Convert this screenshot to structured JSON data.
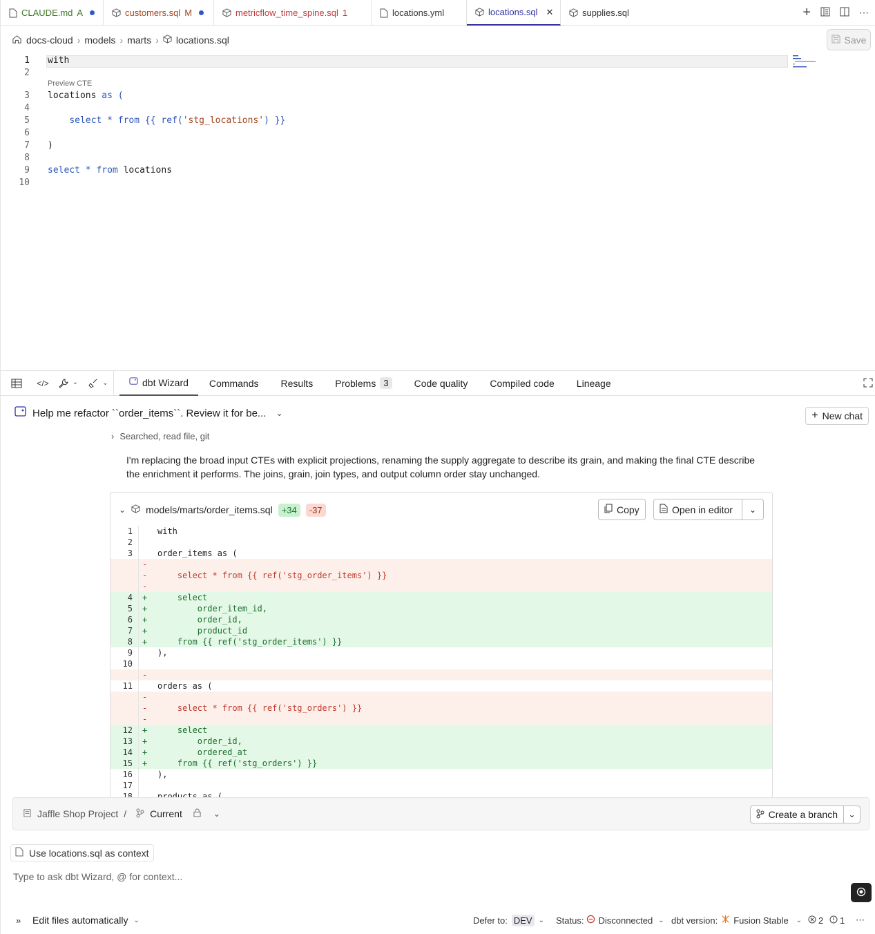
{
  "tabs": [
    {
      "label": "CLAUDE.md",
      "status": "A",
      "dot": true,
      "kind": "file"
    },
    {
      "label": "customers.sql",
      "status": "M",
      "dot": true,
      "kind": "model"
    },
    {
      "label": "metricflow_time_spine.sql",
      "status": "1",
      "dot": false,
      "kind": "model"
    },
    {
      "label": "locations.yml",
      "status": "",
      "dot": false,
      "kind": "file"
    },
    {
      "label": "locations.sql",
      "status": "",
      "dot": false,
      "kind": "model",
      "active": true
    },
    {
      "label": "supplies.sql",
      "status": "",
      "dot": false,
      "kind": "model"
    }
  ],
  "breadcrumb": [
    "docs-cloud",
    "models",
    "marts",
    "locations.sql"
  ],
  "save_label": "Save",
  "editor": {
    "preview_cte": "Preview CTE",
    "lines": [
      {
        "n": "1",
        "code": "with"
      },
      {
        "n": "2",
        "code": ""
      },
      {
        "n": "3",
        "code": "locations as ("
      },
      {
        "n": "4",
        "code": ""
      },
      {
        "n": "5",
        "code": "    select * from {{ ref('stg_locations') }}"
      },
      {
        "n": "6",
        "code": ""
      },
      {
        "n": "7",
        "code": ")"
      },
      {
        "n": "8",
        "code": ""
      },
      {
        "n": "9",
        "code": "select * from locations"
      },
      {
        "n": "10",
        "code": ""
      }
    ]
  },
  "panel": {
    "tabs": [
      "dbt Wizard",
      "Commands",
      "Results",
      "Problems",
      "Code quality",
      "Compiled code",
      "Lineage"
    ],
    "problems_count": "3"
  },
  "chat": {
    "title": "Help me refactor ``order_items``. Review it for be...",
    "new_chat": "New chat",
    "steps": "Searched, read file, git",
    "message": "I'm replacing the broad input CTEs with explicit projections, renaming the supply aggregate to describe its grain, and making the final CTE describe the enrichment it performs. The joins, grain, join types, and output column order stay unchanged."
  },
  "diff": {
    "file": "models/marts/order_items.sql",
    "added": "+34",
    "removed": "-37",
    "copy": "Copy",
    "open_in_editor": "Open in editor",
    "lines": [
      {
        "n": "1",
        "t": "ctx",
        "s": "",
        "code": "with"
      },
      {
        "n": "2",
        "t": "ctx",
        "s": "",
        "code": ""
      },
      {
        "n": "3",
        "t": "ctx",
        "s": "",
        "code": "order_items as ("
      },
      {
        "n": "",
        "t": "del",
        "s": "-",
        "code": ""
      },
      {
        "n": "",
        "t": "del",
        "s": "-",
        "code": "    select * from {{ ref('stg_order_items') }}"
      },
      {
        "n": "",
        "t": "del",
        "s": "-",
        "code": ""
      },
      {
        "n": "4",
        "t": "add",
        "s": "+",
        "code": "    select"
      },
      {
        "n": "5",
        "t": "add",
        "s": "+",
        "code": "        order_item_id,"
      },
      {
        "n": "6",
        "t": "add",
        "s": "+",
        "code": "        order_id,"
      },
      {
        "n": "7",
        "t": "add",
        "s": "+",
        "code": "        product_id"
      },
      {
        "n": "8",
        "t": "add",
        "s": "+",
        "code": "    from {{ ref('stg_order_items') }}"
      },
      {
        "n": "9",
        "t": "ctx",
        "s": "",
        "code": "),"
      },
      {
        "n": "10",
        "t": "ctx",
        "s": "",
        "code": ""
      },
      {
        "n": "",
        "t": "del",
        "s": "-",
        "code": ""
      },
      {
        "n": "11",
        "t": "ctx",
        "s": "",
        "code": "orders as ("
      },
      {
        "n": "",
        "t": "del",
        "s": "-",
        "code": ""
      },
      {
        "n": "",
        "t": "del",
        "s": "-",
        "code": "    select * from {{ ref('stg_orders') }}"
      },
      {
        "n": "",
        "t": "del",
        "s": "-",
        "code": ""
      },
      {
        "n": "12",
        "t": "add",
        "s": "+",
        "code": "    select"
      },
      {
        "n": "13",
        "t": "add",
        "s": "+",
        "code": "        order_id,"
      },
      {
        "n": "14",
        "t": "add",
        "s": "+",
        "code": "        ordered_at"
      },
      {
        "n": "15",
        "t": "add",
        "s": "+",
        "code": "    from {{ ref('stg_orders') }}"
      },
      {
        "n": "16",
        "t": "ctx",
        "s": "",
        "code": "),"
      },
      {
        "n": "17",
        "t": "ctx",
        "s": "",
        "code": ""
      },
      {
        "n": "18",
        "t": "ctx",
        "s": "",
        "code": "products as ("
      }
    ]
  },
  "project": {
    "name": "Jaffle Shop Project",
    "sep": "/",
    "branch": "Current",
    "create_branch": "Create a branch"
  },
  "context_chip": "Use locations.sql as context",
  "input_placeholder": "Type to ask dbt Wizard, @ for context...",
  "status": {
    "edit_mode": "Edit files automatically",
    "defer_label": "Defer to:",
    "defer_value": "DEV",
    "status_label": "Status:",
    "status_value": "Disconnected",
    "version_label": "dbt version:",
    "version_value": "Fusion Stable",
    "errors": "2",
    "warnings": "1"
  },
  "colors": {
    "accent": "#2d2fa3",
    "add_bg": "#e3f8e6",
    "del_bg": "#fdf0eb",
    "error": "#c0392b"
  }
}
